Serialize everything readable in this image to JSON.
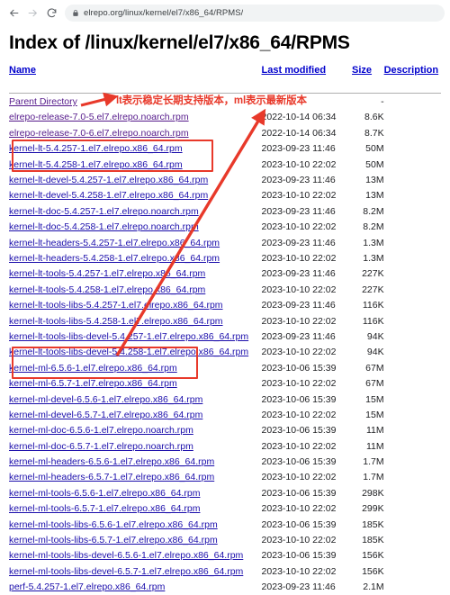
{
  "browser": {
    "back_icon": "arrow-left-icon",
    "forward_icon": "arrow-right-icon",
    "reload_icon": "reload-icon",
    "lock_icon": "lock-icon",
    "url": "elrepo.org/linux/kernel/el7/x86_64/RPMS/"
  },
  "page": {
    "title": "Index of /linux/kernel/el7/x86_64/RPMS",
    "columns": {
      "name": "Name",
      "last_modified": "Last modified",
      "size": "Size",
      "description": "Description"
    },
    "rows": [
      {
        "name": "Parent Directory",
        "modified": "",
        "size": "-",
        "desc": "",
        "visited": true
      },
      {
        "name": "elrepo-release-7.0-5.el7.elrepo.noarch.rpm",
        "modified": "2022-10-14 06:34",
        "size": "8.6K",
        "desc": "",
        "visited": true
      },
      {
        "name": "elrepo-release-7.0-6.el7.elrepo.noarch.rpm",
        "modified": "2022-10-14 06:34",
        "size": "8.7K",
        "desc": "",
        "visited": true
      },
      {
        "name": "kernel-lt-5.4.257-1.el7.elrepo.x86_64.rpm",
        "modified": "2023-09-23 11:46",
        "size": "50M",
        "desc": "",
        "visited": false
      },
      {
        "name": "kernel-lt-5.4.258-1.el7.elrepo.x86_64.rpm",
        "modified": "2023-10-10 22:02",
        "size": "50M",
        "desc": "",
        "visited": false
      },
      {
        "name": "kernel-lt-devel-5.4.257-1.el7.elrepo.x86_64.rpm",
        "modified": "2023-09-23 11:46",
        "size": "13M",
        "desc": "",
        "visited": false
      },
      {
        "name": "kernel-lt-devel-5.4.258-1.el7.elrepo.x86_64.rpm",
        "modified": "2023-10-10 22:02",
        "size": "13M",
        "desc": "",
        "visited": false
      },
      {
        "name": "kernel-lt-doc-5.4.257-1.el7.elrepo.noarch.rpm",
        "modified": "2023-09-23 11:46",
        "size": "8.2M",
        "desc": "",
        "visited": false
      },
      {
        "name": "kernel-lt-doc-5.4.258-1.el7.elrepo.noarch.rpm",
        "modified": "2023-10-10 22:02",
        "size": "8.2M",
        "desc": "",
        "visited": false
      },
      {
        "name": "kernel-lt-headers-5.4.257-1.el7.elrepo.x86_64.rpm",
        "modified": "2023-09-23 11:46",
        "size": "1.3M",
        "desc": "",
        "visited": false
      },
      {
        "name": "kernel-lt-headers-5.4.258-1.el7.elrepo.x86_64.rpm",
        "modified": "2023-10-10 22:02",
        "size": "1.3M",
        "desc": "",
        "visited": false
      },
      {
        "name": "kernel-lt-tools-5.4.257-1.el7.elrepo.x86_64.rpm",
        "modified": "2023-09-23 11:46",
        "size": "227K",
        "desc": "",
        "visited": false
      },
      {
        "name": "kernel-lt-tools-5.4.258-1.el7.elrepo.x86_64.rpm",
        "modified": "2023-10-10 22:02",
        "size": "227K",
        "desc": "",
        "visited": false
      },
      {
        "name": "kernel-lt-tools-libs-5.4.257-1.el7.elrepo.x86_64.rpm",
        "modified": "2023-09-23 11:46",
        "size": "116K",
        "desc": "",
        "visited": false
      },
      {
        "name": "kernel-lt-tools-libs-5.4.258-1.el7.elrepo.x86_64.rpm",
        "modified": "2023-10-10 22:02",
        "size": "116K",
        "desc": "",
        "visited": false
      },
      {
        "name": "kernel-lt-tools-libs-devel-5.4.257-1.el7.elrepo.x86_64.rpm",
        "modified": "2023-09-23 11:46",
        "size": "94K",
        "desc": "",
        "visited": false
      },
      {
        "name": "kernel-lt-tools-libs-devel-5.4.258-1.el7.elrepo.x86_64.rpm",
        "modified": "2023-10-10 22:02",
        "size": "94K",
        "desc": "",
        "visited": false
      },
      {
        "name": "kernel-ml-6.5.6-1.el7.elrepo.x86_64.rpm",
        "modified": "2023-10-06 15:39",
        "size": "67M",
        "desc": "",
        "visited": false
      },
      {
        "name": "kernel-ml-6.5.7-1.el7.elrepo.x86_64.rpm",
        "modified": "2023-10-10 22:02",
        "size": "67M",
        "desc": "",
        "visited": false
      },
      {
        "name": "kernel-ml-devel-6.5.6-1.el7.elrepo.x86_64.rpm",
        "modified": "2023-10-06 15:39",
        "size": "15M",
        "desc": "",
        "visited": false
      },
      {
        "name": "kernel-ml-devel-6.5.7-1.el7.elrepo.x86_64.rpm",
        "modified": "2023-10-10 22:02",
        "size": "15M",
        "desc": "",
        "visited": false
      },
      {
        "name": "kernel-ml-doc-6.5.6-1.el7.elrepo.noarch.rpm",
        "modified": "2023-10-06 15:39",
        "size": "11M",
        "desc": "",
        "visited": false
      },
      {
        "name": "kernel-ml-doc-6.5.7-1.el7.elrepo.noarch.rpm",
        "modified": "2023-10-10 22:02",
        "size": "11M",
        "desc": "",
        "visited": false
      },
      {
        "name": "kernel-ml-headers-6.5.6-1.el7.elrepo.x86_64.rpm",
        "modified": "2023-10-06 15:39",
        "size": "1.7M",
        "desc": "",
        "visited": false
      },
      {
        "name": "kernel-ml-headers-6.5.7-1.el7.elrepo.x86_64.rpm",
        "modified": "2023-10-10 22:02",
        "size": "1.7M",
        "desc": "",
        "visited": false
      },
      {
        "name": "kernel-ml-tools-6.5.6-1.el7.elrepo.x86_64.rpm",
        "modified": "2023-10-06 15:39",
        "size": "298K",
        "desc": "",
        "visited": false
      },
      {
        "name": "kernel-ml-tools-6.5.7-1.el7.elrepo.x86_64.rpm",
        "modified": "2023-10-10 22:02",
        "size": "299K",
        "desc": "",
        "visited": false
      },
      {
        "name": "kernel-ml-tools-libs-6.5.6-1.el7.elrepo.x86_64.rpm",
        "modified": "2023-10-06 15:39",
        "size": "185K",
        "desc": "",
        "visited": false
      },
      {
        "name": "kernel-ml-tools-libs-6.5.7-1.el7.elrepo.x86_64.rpm",
        "modified": "2023-10-10 22:02",
        "size": "185K",
        "desc": "",
        "visited": false
      },
      {
        "name": "kernel-ml-tools-libs-devel-6.5.6-1.el7.elrepo.x86_64.rpm",
        "modified": "2023-10-06 15:39",
        "size": "156K",
        "desc": "",
        "visited": false
      },
      {
        "name": "kernel-ml-tools-libs-devel-6.5.7-1.el7.elrepo.x86_64.rpm",
        "modified": "2023-10-10 22:02",
        "size": "156K",
        "desc": "",
        "visited": false
      },
      {
        "name": "perf-5.4.257-1.el7.elrepo.x86_64.rpm",
        "modified": "2023-09-23 11:46",
        "size": "2.1M",
        "desc": "",
        "visited": false
      }
    ]
  },
  "annotations": {
    "color": "#e8392a",
    "note": "lt表示稳定长期支持版本，ml表示最新版本",
    "highlight_lt_label": "kernel-lt highlight box",
    "highlight_ml_label": "kernel-ml highlight box"
  }
}
